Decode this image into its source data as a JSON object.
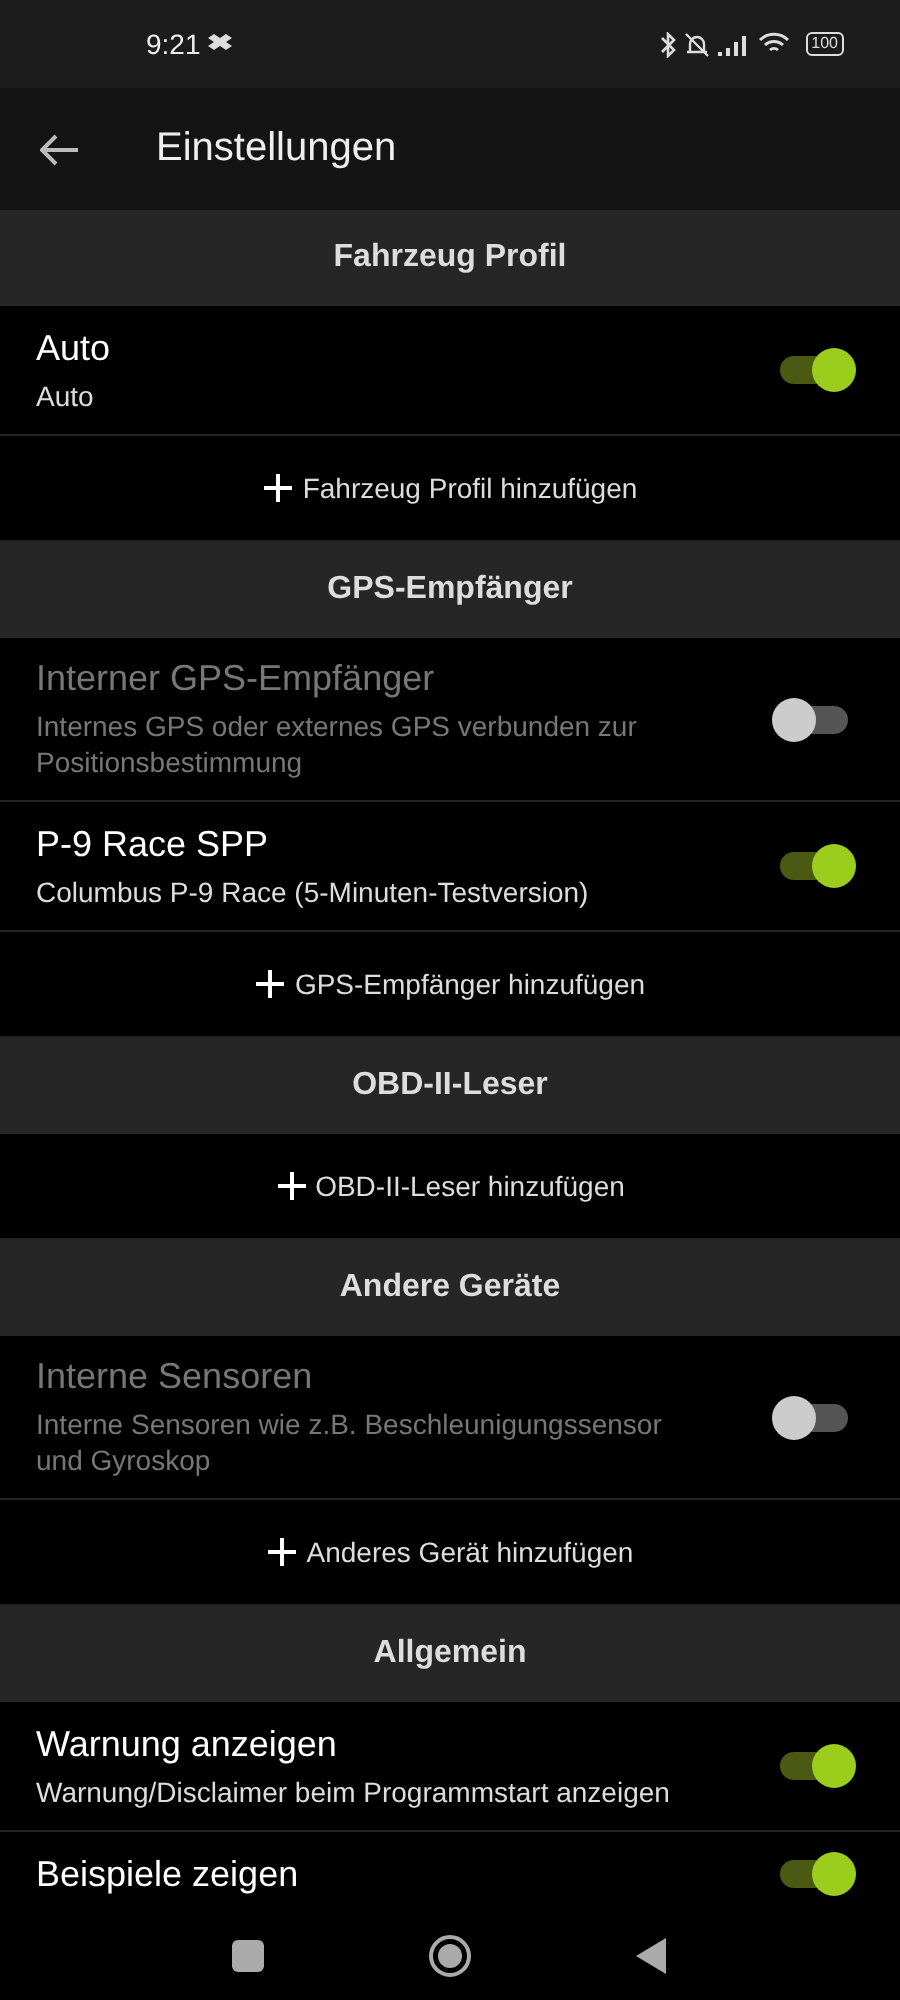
{
  "status_bar": {
    "time": "9:21",
    "battery": "100"
  },
  "app_bar": {
    "title": "Einstellungen"
  },
  "sections": [
    {
      "title": "Fahrzeug Profil",
      "items": [
        {
          "kind": "toggle",
          "title": "Auto",
          "subtitle": "Auto",
          "on": true,
          "disabled": false
        },
        {
          "kind": "add",
          "label": "Fahrzeug Profil hinzufügen"
        }
      ]
    },
    {
      "title": "GPS-Empfänger",
      "items": [
        {
          "kind": "toggle",
          "title": "Interner GPS-Empfänger",
          "subtitle": "Internes GPS oder externes GPS verbunden zur Positionsbestimmung",
          "on": false,
          "disabled": true
        },
        {
          "kind": "toggle",
          "title": "P-9 Race SPP",
          "subtitle": "Columbus P-9 Race (5-Minuten-Testversion)",
          "on": true,
          "disabled": false
        },
        {
          "kind": "add",
          "label": "GPS-Empfänger hinzufügen"
        }
      ]
    },
    {
      "title": "OBD-II-Leser",
      "items": [
        {
          "kind": "add",
          "label": "OBD-II-Leser hinzufügen"
        }
      ]
    },
    {
      "title": "Andere Geräte",
      "items": [
        {
          "kind": "toggle",
          "title": "Interne Sensoren",
          "subtitle": "Interne Sensoren wie z.B. Beschleunigungssensor und Gyroskop",
          "on": false,
          "disabled": true
        },
        {
          "kind": "add",
          "label": "Anderes Gerät hinzufügen"
        }
      ]
    },
    {
      "title": "Allgemein",
      "items": [
        {
          "kind": "toggle",
          "title": "Warnung anzeigen",
          "subtitle": "Warnung/Disclaimer beim Programmstart anzeigen",
          "on": true,
          "disabled": false
        },
        {
          "kind": "toggle",
          "title": "Beispiele zeigen",
          "on": true,
          "disabled": false
        }
      ]
    }
  ]
}
